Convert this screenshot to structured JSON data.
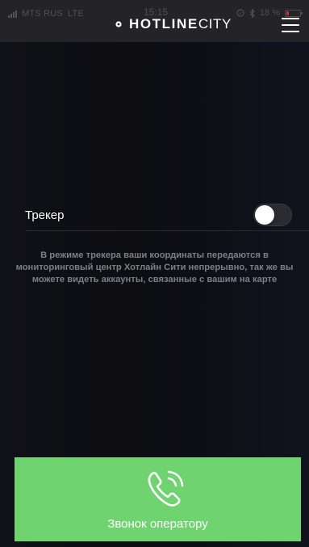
{
  "status_bar": {
    "carrier": "MTS RUS",
    "network": "LTE",
    "time": "15:15",
    "battery_percent": "18 %",
    "battery_level": 0.18,
    "icons": [
      "signal-icon",
      "location-icon",
      "bluetooth-icon",
      "battery-icon"
    ]
  },
  "header": {
    "brand_bold": "HOTLINE",
    "brand_light": "CITY",
    "menu_icon": "hamburger-menu-icon"
  },
  "tracker": {
    "label": "Трекер",
    "enabled": false,
    "description": "В режиме трекера ваши координаты передаются в мониторинговый центр Хотлайн Сити непрерывно, так же вы можете видеть аккаунты, связанные с вашим на карте"
  },
  "call_button": {
    "label": "Звонок оператору",
    "icon": "phone-ringing-icon"
  },
  "colors": {
    "background": "#0f1016",
    "header": "#232328",
    "call_button": "#6fd46f",
    "description_text": "#7d7f88",
    "battery_low": "#d52b2b"
  }
}
